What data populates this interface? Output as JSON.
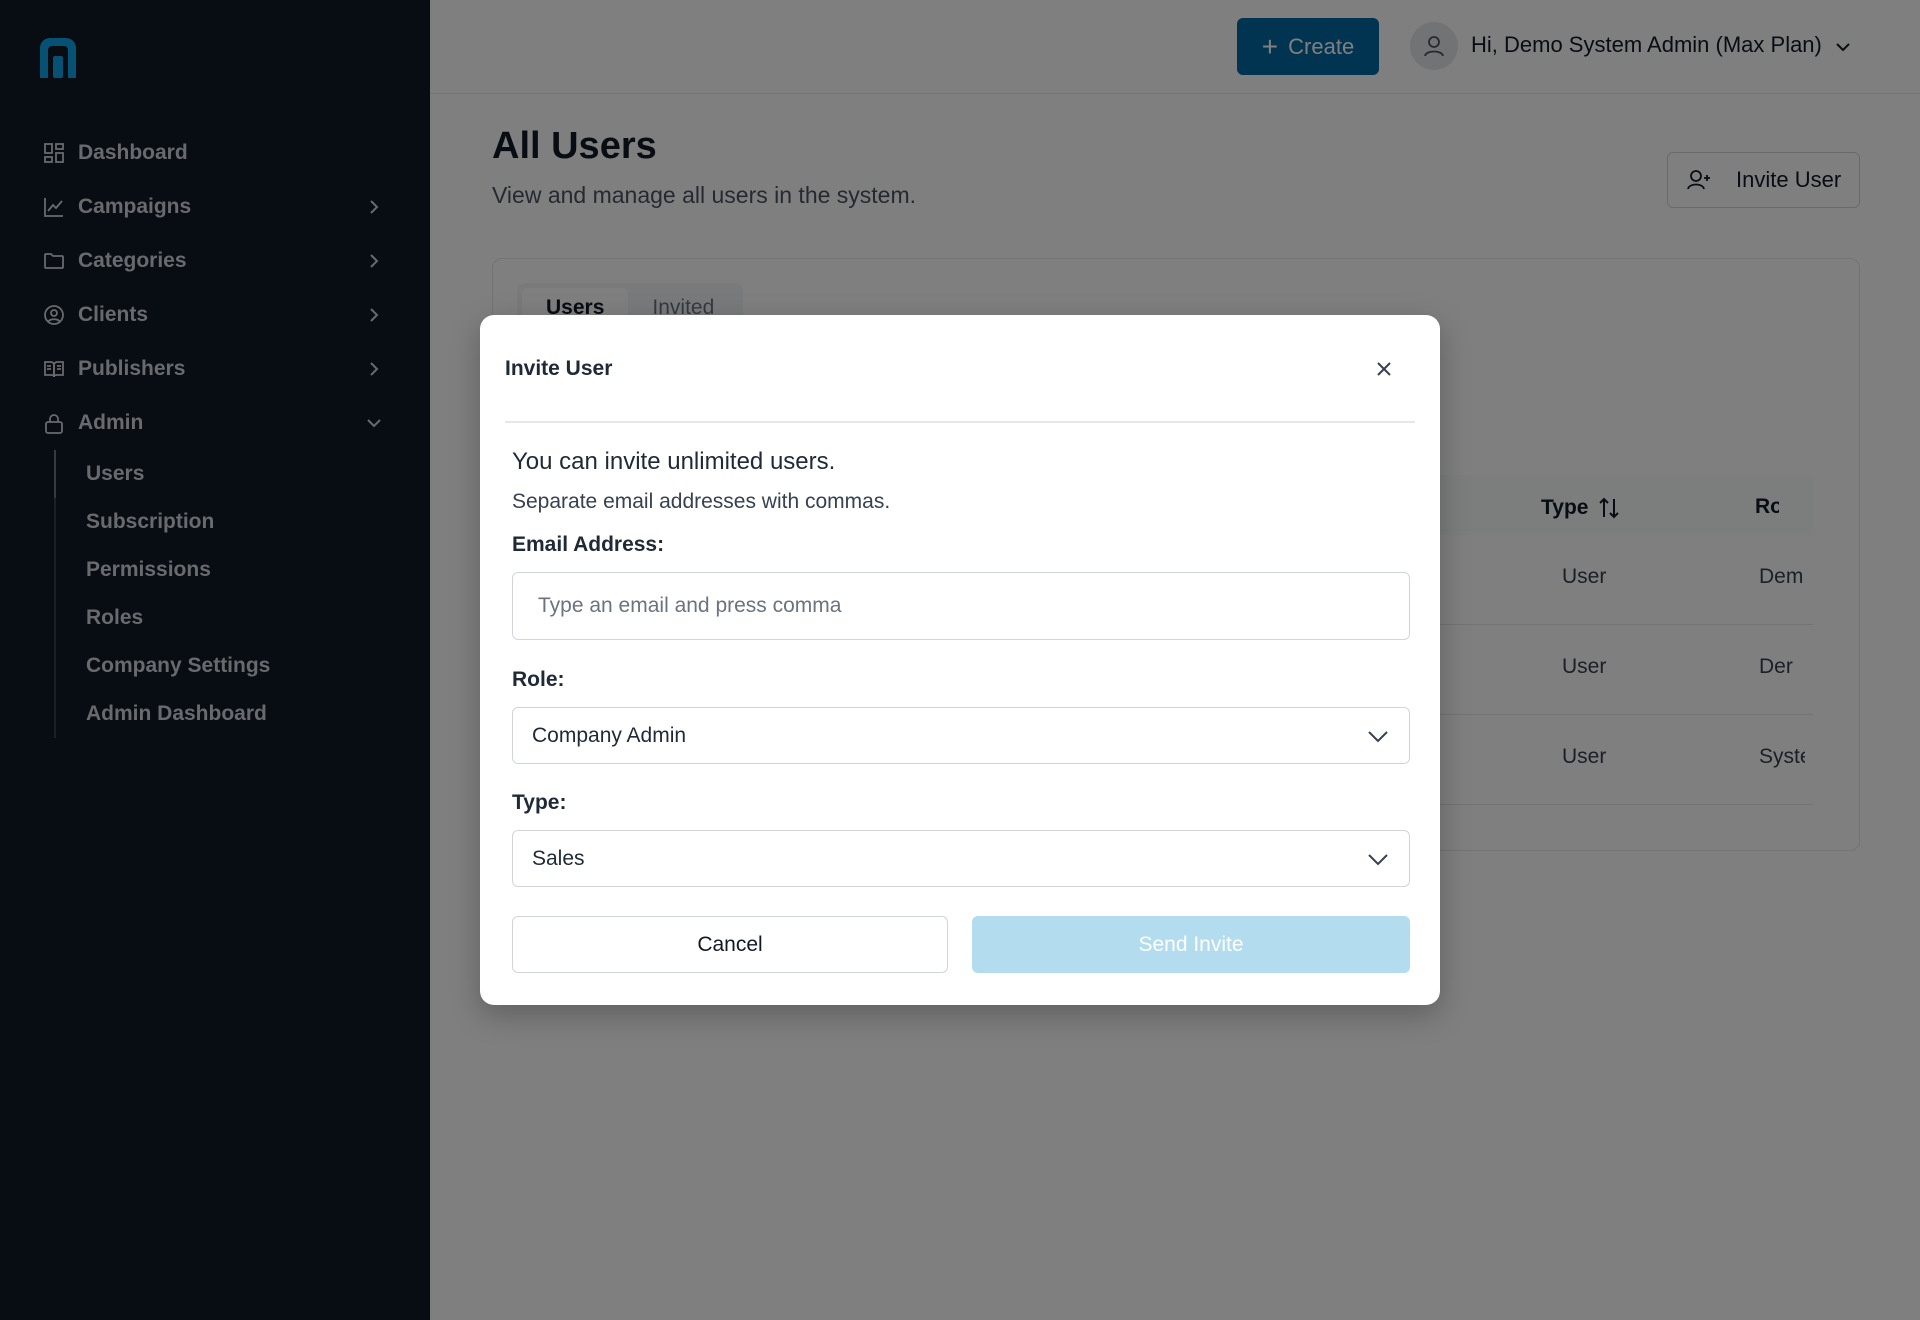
{
  "colors": {
    "sidebar_bg": "#111827",
    "accent": "#0369a1",
    "logo": "#0ea5e9",
    "send_disabled": "#b3dcef"
  },
  "sidebar": {
    "logo_icon": "brand-logo-icon",
    "items": [
      {
        "label": "Dashboard",
        "icon": "dashboard-grid-icon",
        "expandable": false
      },
      {
        "label": "Campaigns",
        "icon": "line-chart-icon",
        "expandable": true
      },
      {
        "label": "Categories",
        "icon": "folder-icon",
        "expandable": true
      },
      {
        "label": "Clients",
        "icon": "user-circle-icon",
        "expandable": true
      },
      {
        "label": "Publishers",
        "icon": "book-open-icon",
        "expandable": true
      },
      {
        "label": "Admin",
        "icon": "lock-icon",
        "expandable": true,
        "expanded": true
      }
    ],
    "admin_subitems": [
      "Users",
      "Subscription",
      "Permissions",
      "Roles",
      "Company Settings",
      "Admin Dashboard"
    ]
  },
  "header": {
    "create_label": "Create",
    "user_greeting": "Hi, Demo System Admin (Max Plan)"
  },
  "page": {
    "title": "All Users",
    "subtitle": "View and manage all users in the system.",
    "invite_button": "Invite User",
    "tabs": [
      "Users",
      "Invited"
    ],
    "active_tab": "Users",
    "columns": {
      "type": "Type",
      "role": "Ro"
    },
    "rows": [
      {
        "type": "User",
        "role": "Dem"
      },
      {
        "type": "User",
        "role": "Der"
      },
      {
        "type": "User",
        "role": "Syste"
      }
    ]
  },
  "modal": {
    "title": "Invite User",
    "info_primary": "You can invite unlimited users.",
    "info_secondary": "Separate email addresses with commas.",
    "email_label": "Email Address:",
    "email_value": "",
    "email_placeholder": "Type an email and press comma",
    "role_label": "Role:",
    "role_value": "Company Admin",
    "type_label": "Type:",
    "type_value": "Sales",
    "cancel_label": "Cancel",
    "send_label": "Send Invite"
  }
}
